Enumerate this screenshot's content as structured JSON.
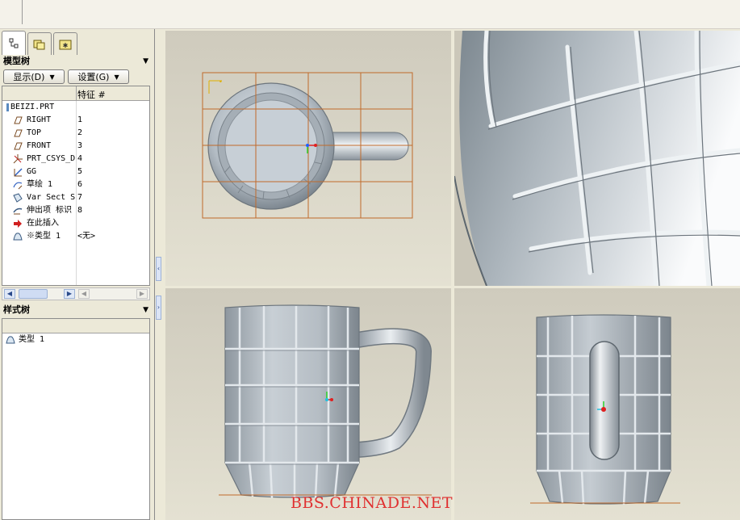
{
  "model_panel": {
    "title": "模型树",
    "show_button": "显示(D)",
    "settings_button": "设置(G)",
    "column_feature": "特征 #",
    "root": "BEIZI.PRT",
    "items": [
      {
        "name": "RIGHT",
        "index": "1",
        "icon": "datum-plane-icon"
      },
      {
        "name": "TOP",
        "index": "2",
        "icon": "datum-plane-icon"
      },
      {
        "name": "FRONT",
        "index": "3",
        "icon": "datum-plane-icon"
      },
      {
        "name": "PRT_CSYS_D",
        "index": "4",
        "icon": "coordinate-system-icon"
      },
      {
        "name": "GG",
        "index": "5",
        "icon": "datum-axis-icon"
      },
      {
        "name": "草绘 1",
        "index": "6",
        "icon": "sketch-icon"
      },
      {
        "name": "Var Sect S",
        "index": "7",
        "icon": "variable-section-sweep-icon"
      },
      {
        "name": "伸出项 标识",
        "index": "8",
        "icon": "extrude-icon"
      },
      {
        "name": "在此插入",
        "index": "",
        "icon": "insert-here-arrow-icon"
      },
      {
        "name": "※类型 1",
        "index": "<无>",
        "icon": "style-feature-icon"
      }
    ]
  },
  "style_panel": {
    "title": "样式树",
    "items": [
      {
        "name": "类型 1",
        "icon": "style-feature-icon"
      }
    ]
  },
  "watermark": "BBS.CHINADE.NET",
  "colors": {
    "accent_red": "#e03030",
    "grid_orange": "#c06a2a",
    "panel_bg": "#ece9d8",
    "model_gray": "#a9b2ba"
  }
}
